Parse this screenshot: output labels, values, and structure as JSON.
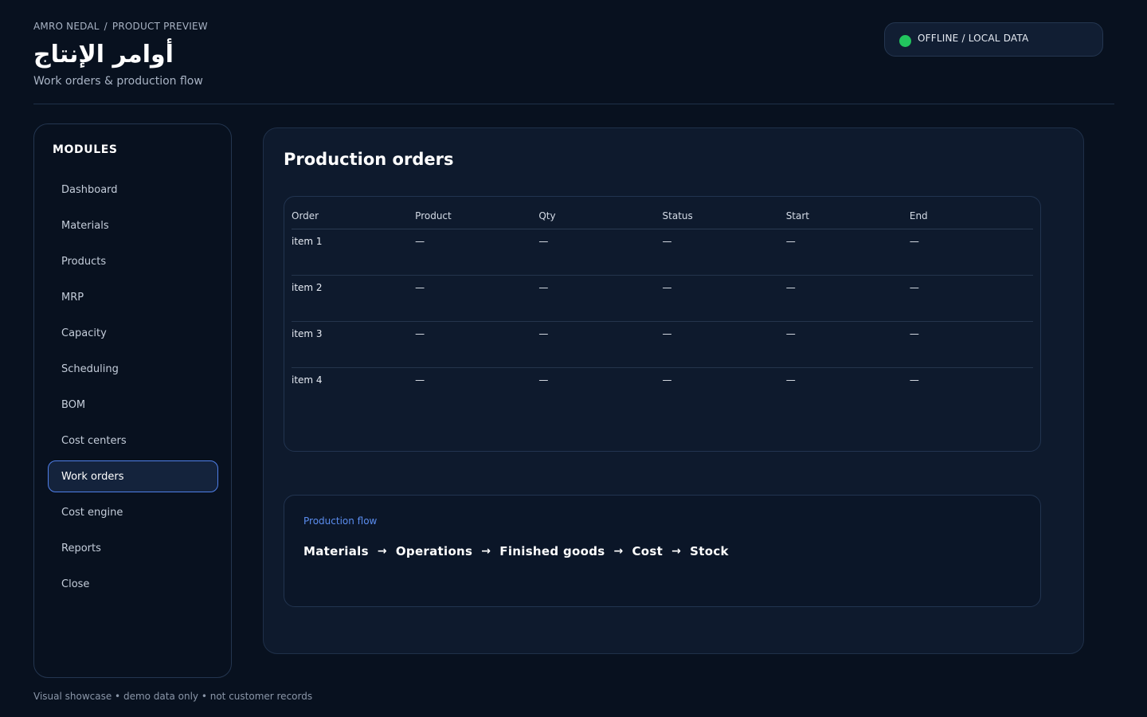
{
  "header": {
    "breadcrumb": [
      "AMRO NEDAL",
      "/",
      "PRODUCT PREVIEW"
    ],
    "title": "أوامر الإنتاج",
    "subtitle": "Work orders & production flow"
  },
  "status": {
    "label": "OFFLINE / LOCAL DATA",
    "color": "#22c55e"
  },
  "sidebar": {
    "heading": "MODULES",
    "items": [
      {
        "label": "Dashboard",
        "active": false
      },
      {
        "label": "Materials",
        "active": false
      },
      {
        "label": "Products",
        "active": false
      },
      {
        "label": "MRP",
        "active": false
      },
      {
        "label": "Capacity",
        "active": false
      },
      {
        "label": "Scheduling",
        "active": false
      },
      {
        "label": "BOM",
        "active": false
      },
      {
        "label": "Cost centers",
        "active": false
      },
      {
        "label": "Work orders",
        "active": true
      },
      {
        "label": "Cost engine",
        "active": false
      },
      {
        "label": "Reports",
        "active": false
      },
      {
        "label": "Close",
        "active": false
      }
    ]
  },
  "main": {
    "title": "Production orders",
    "table": {
      "columns": [
        "Order",
        "Product",
        "Qty",
        "Status",
        "Start",
        "End"
      ],
      "rows": [
        [
          "item 1",
          "—",
          "—",
          "—",
          "—",
          "—"
        ],
        [
          "item 2",
          "—",
          "—",
          "—",
          "—",
          "—"
        ],
        [
          "item 3",
          "—",
          "—",
          "—",
          "—",
          "—"
        ],
        [
          "item 4",
          "—",
          "—",
          "—",
          "—",
          "—"
        ]
      ]
    },
    "flow": {
      "label": "Production flow",
      "steps": [
        "Materials",
        "Operations",
        "Finished goods",
        "Cost",
        "Stock"
      ],
      "arrow": "→"
    }
  },
  "footer": {
    "text": "Visual showcase • demo data only • not customer records"
  },
  "colors": {
    "background": "#08111f",
    "accent": "#4f7fe8",
    "flow_label": "#5b8def",
    "status_online": "#22c55e"
  }
}
